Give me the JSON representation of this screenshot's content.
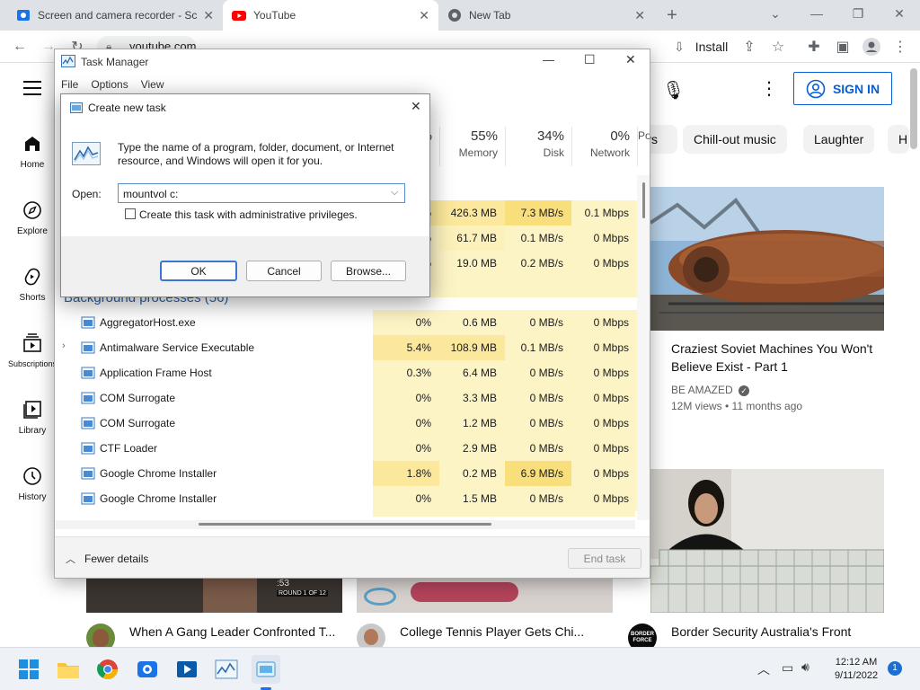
{
  "browser": {
    "tabs": [
      {
        "title": "Screen and camera recorder - Sc"
      },
      {
        "title": "YouTube"
      },
      {
        "title": "New Tab"
      }
    ],
    "address": "youtube.com",
    "install_label": "Install"
  },
  "youtube": {
    "nav": [
      {
        "label": "Home"
      },
      {
        "label": "Explore"
      },
      {
        "label": "Shorts"
      },
      {
        "label": "Subscriptions"
      },
      {
        "label": "Library"
      },
      {
        "label": "History"
      }
    ],
    "sign_in": "SIGN IN",
    "chips": [
      "vs",
      "Chill-out music",
      "Laughter",
      "H"
    ],
    "videos": [
      {
        "title": "Craziest Soviet Machines You Won't Believe Exist - Part 1",
        "channel": "BE AMAZED",
        "meta": "12M views • 11 months ago"
      },
      {
        "title": "When A Gang Leader Confronted T..."
      },
      {
        "title": "College Tennis Player Gets Chi..."
      },
      {
        "title": "Border Security Australia's Front Line..."
      }
    ],
    "thumb_overlay": "ROUND 1 OF 12",
    "thumb_score": ":53",
    "border_logo": "BORDER FORCE"
  },
  "task_manager": {
    "title": "Task Manager",
    "menu": [
      "File",
      "Options",
      "View"
    ],
    "columns": [
      {
        "pct": "55%",
        "label": "Memory"
      },
      {
        "pct": "34%",
        "label": "Disk"
      },
      {
        "pct": "0%",
        "label": "Network"
      },
      {
        "pct": "",
        "label": "Po"
      }
    ],
    "partial_col": "%",
    "app_rows": [
      {
        "cpu": "%",
        "mem": "426.3 MB",
        "disk": "7.3 MB/s",
        "net": "0.1 Mbps"
      },
      {
        "cpu": "%",
        "mem": "61.7 MB",
        "disk": "0.1 MB/s",
        "net": "0 Mbps"
      },
      {
        "cpu": "%",
        "mem": "19.0 MB",
        "disk": "0.2 MB/s",
        "net": "0 Mbps"
      }
    ],
    "section": "Background processes (56)",
    "processes": [
      {
        "name": "AggregatorHost.exe",
        "cpu": "0%",
        "mem": "0.6 MB",
        "disk": "0 MB/s",
        "net": "0 Mbps",
        "expand": ""
      },
      {
        "name": "Antimalware Service Executable",
        "cpu": "5.4%",
        "mem": "108.9 MB",
        "disk": "0.1 MB/s",
        "net": "0 Mbps",
        "expand": "›"
      },
      {
        "name": "Application Frame Host",
        "cpu": "0.3%",
        "mem": "6.4 MB",
        "disk": "0 MB/s",
        "net": "0 Mbps",
        "expand": ""
      },
      {
        "name": "COM Surrogate",
        "cpu": "0%",
        "mem": "3.3 MB",
        "disk": "0 MB/s",
        "net": "0 Mbps",
        "expand": ""
      },
      {
        "name": "COM Surrogate",
        "cpu": "0%",
        "mem": "1.2 MB",
        "disk": "0 MB/s",
        "net": "0 Mbps",
        "expand": ""
      },
      {
        "name": "CTF Loader",
        "cpu": "0%",
        "mem": "2.9 MB",
        "disk": "0 MB/s",
        "net": "0 Mbps",
        "expand": ""
      },
      {
        "name": "Google Chrome Installer",
        "cpu": "1.8%",
        "mem": "0.2 MB",
        "disk": "6.9 MB/s",
        "net": "0 Mbps",
        "expand": ""
      },
      {
        "name": "Google Chrome Installer",
        "cpu": "0%",
        "mem": "1.5 MB",
        "disk": "0 MB/s",
        "net": "0 Mbps",
        "expand": ""
      }
    ],
    "fewer_details": "Fewer details",
    "end_task": "End task"
  },
  "dialog": {
    "title": "Create new task",
    "description": "Type the name of a program, folder, document, or Internet resource, and Windows will open it for you.",
    "open_label": "Open:",
    "open_value": "mountvol c:",
    "admin_label": "Create this task with administrative privileges.",
    "ok": "OK",
    "cancel": "Cancel",
    "browse": "Browse..."
  },
  "taskbar": {
    "time": "12:12 AM",
    "date": "9/11/2022",
    "notifications": "1"
  }
}
